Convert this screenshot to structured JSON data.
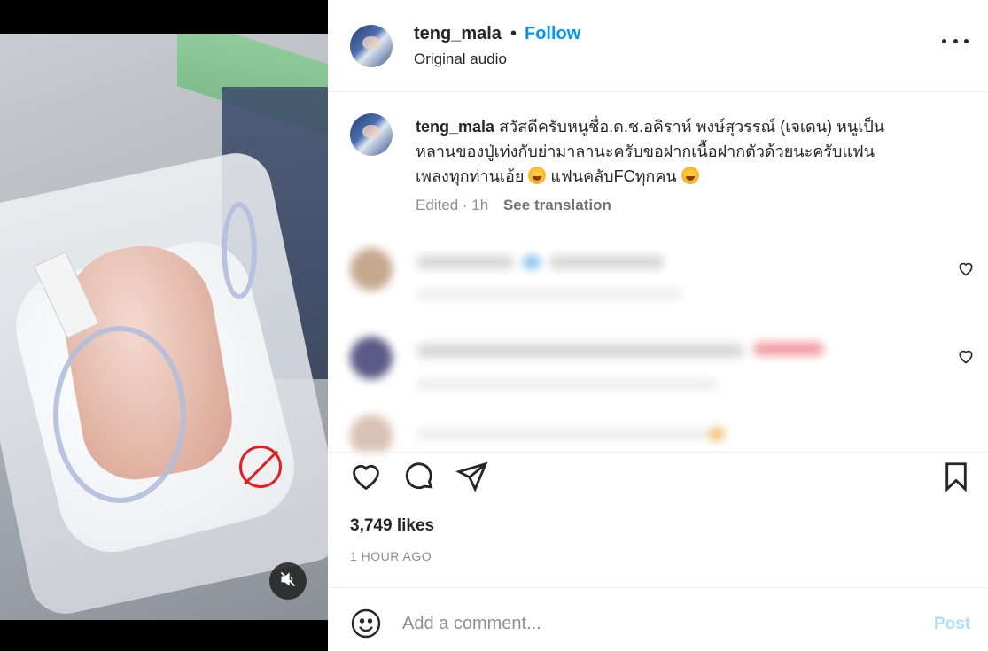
{
  "post": {
    "username": "teng_mala",
    "separator": "•",
    "follow_label": "Follow",
    "audio": "Original audio"
  },
  "caption": {
    "username": "teng_mala",
    "text_line1": "สวัสดีครับหนูชื่อ.ด.ช.อคิราห์ พงษ์สุวรรณ์ (เจเดน) หนูเป็น",
    "text_line2": "หลานของปู่เท่งกับย่ามาลานะครับขอฝากเนื้อฝากตัวด้วยนะครับแฟน",
    "text_line3a": "เพลงทุกท่านเอ้ย",
    "text_line3b": "แฟนคลับFCทุกคน",
    "emoji": "rolling-on-floor-laughing-emoji",
    "edited": "Edited · 1h",
    "see_translation": "See translation"
  },
  "engagement": {
    "likes": "3,749 likes",
    "time": "1 HOUR AGO"
  },
  "comment_box": {
    "placeholder": "Add a comment...",
    "post_label": "Post"
  },
  "colors": {
    "accent": "#0095f6",
    "post_disabled": "#b3dbff",
    "text": "#262626",
    "muted": "#8e8e8e"
  }
}
